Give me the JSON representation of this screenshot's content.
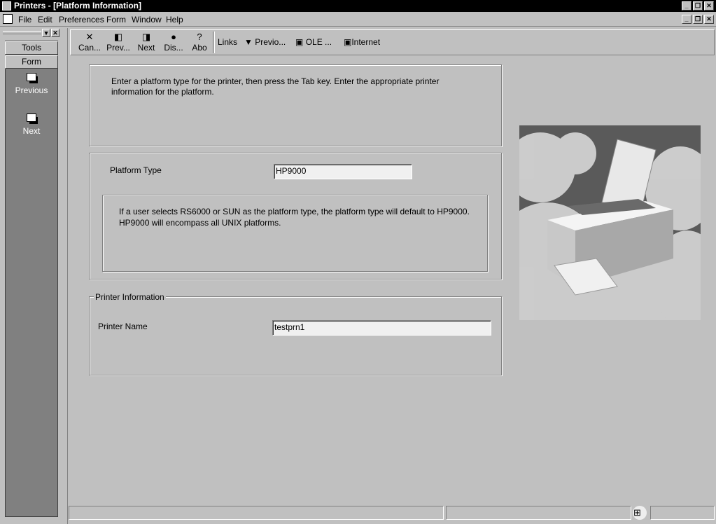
{
  "window": {
    "title": "Printers - [Platform Information]"
  },
  "menu": [
    "File",
    "Edit",
    "Preferences",
    "Form",
    "Window",
    "Help"
  ],
  "sidebar": {
    "tabs": [
      "Tools",
      "Form"
    ],
    "items": [
      "Previous",
      "Next"
    ]
  },
  "toolbar": {
    "buttons": [
      "Can...",
      "Prev...",
      "Next",
      "Dis...",
      "Abo"
    ],
    "links_label": "Links",
    "links": [
      "Previo...",
      "OLE ...",
      "Internet"
    ]
  },
  "form": {
    "instructions": "Enter a platform type for the printer, then press the Tab key.  Enter the appropriate printer information for the platform.",
    "platform_type_label": "Platform Type",
    "platform_type_value": "HP9000",
    "platform_note": "If a user selects RS6000 or SUN as the platform type, the platform type will default to HP9000. HP9000 will encompass all UNIX platforms.",
    "printer_info_title": "Printer Information",
    "printer_name_label": "Printer Name",
    "printer_name_value": "testprn1"
  }
}
